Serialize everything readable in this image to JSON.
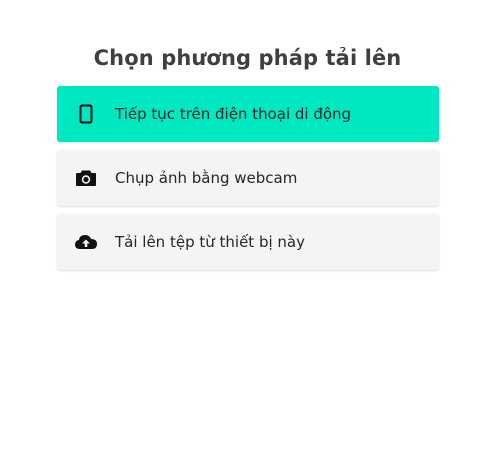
{
  "title": "Chọn phương pháp tải lên",
  "options": [
    {
      "label": "Tiếp tục trên điện thoại di động",
      "icon": "mobile-phone-icon",
      "style": "primary",
      "color": "#00e8c2"
    },
    {
      "label": "Chụp ảnh bằng webcam",
      "icon": "camera-icon",
      "style": "secondary",
      "color": "#f4f4f4"
    },
    {
      "label": "Tải lên tệp từ thiết bị này",
      "icon": "cloud-upload-icon",
      "style": "secondary",
      "color": "#f4f4f4"
    }
  ]
}
